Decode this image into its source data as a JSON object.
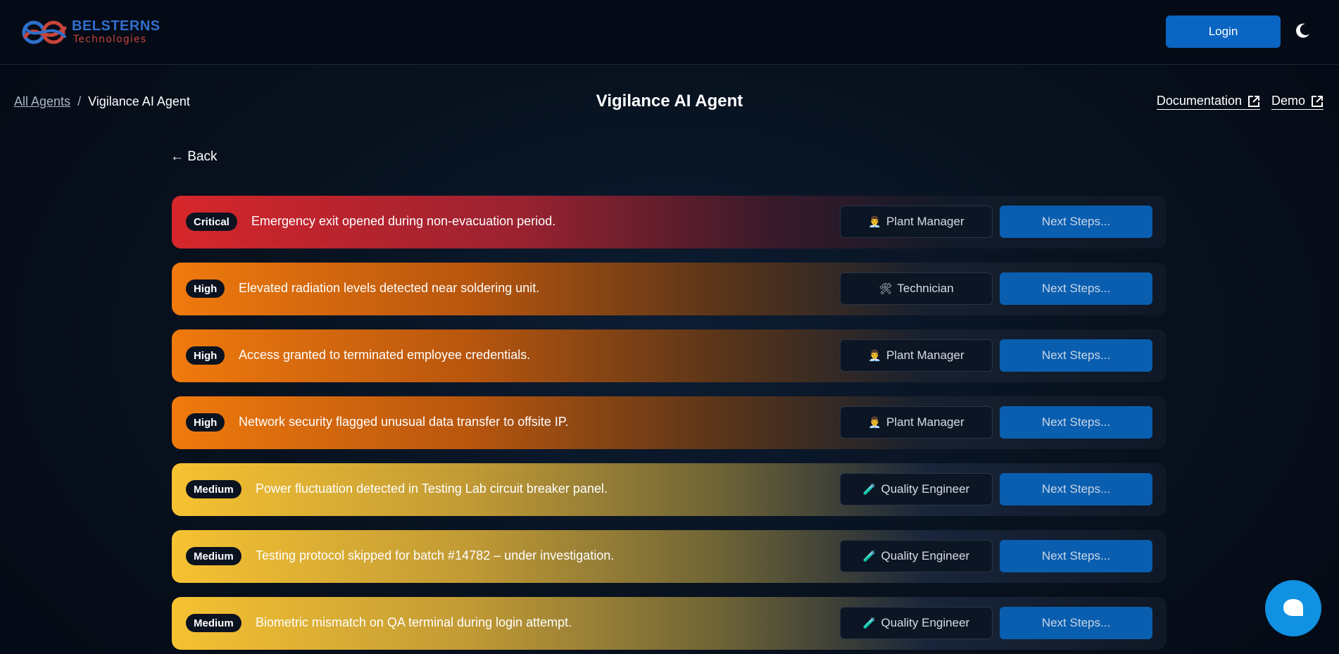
{
  "header": {
    "logo_primary": "BELSTERNS",
    "logo_secondary": "Technologies",
    "login_label": "Login",
    "theme_icon": "moon-icon"
  },
  "breadcrumb": {
    "parent_label": "All Agents",
    "separator": "/",
    "current_label": "Vigilance AI Agent"
  },
  "page": {
    "title": "Vigilance AI Agent",
    "back_label": "← Back"
  },
  "links": {
    "documentation_label": "Documentation",
    "demo_label": "Demo",
    "external_icon": "external-link-icon"
  },
  "alerts": [
    {
      "severity": "Critical",
      "message": "Emergency exit opened during non-evacuation period.",
      "role": "Plant Manager",
      "role_icon": "👨‍💼",
      "action": "Next Steps..."
    },
    {
      "severity": "High",
      "message": "Elevated radiation levels detected near soldering unit.",
      "role": "Technician",
      "role_icon": "🛠",
      "action": "Next Steps..."
    },
    {
      "severity": "High",
      "message": "Access granted to terminated employee credentials.",
      "role": "Plant Manager",
      "role_icon": "👨‍💼",
      "action": "Next Steps..."
    },
    {
      "severity": "High",
      "message": "Network security flagged unusual data transfer to offsite IP.",
      "role": "Plant Manager",
      "role_icon": "👨‍💼",
      "action": "Next Steps..."
    },
    {
      "severity": "Medium",
      "message": "Power fluctuation detected in Testing Lab circuit breaker panel.",
      "role": "Quality Engineer",
      "role_icon": "🧪",
      "action": "Next Steps..."
    },
    {
      "severity": "Medium",
      "message": "Testing protocol skipped for batch #14782 – under investigation.",
      "role": "Quality Engineer",
      "role_icon": "🧪",
      "action": "Next Steps..."
    },
    {
      "severity": "Medium",
      "message": "Biometric mismatch on QA terminal during login attempt.",
      "role": "Quality Engineer",
      "role_icon": "🧪",
      "action": "Next Steps..."
    }
  ],
  "colors": {
    "critical": "#d6262b",
    "high": "#f07a0d",
    "medium": "#f6c232",
    "primary_button": "#0a64c2",
    "chat_button": "#1191e2"
  },
  "chat": {
    "icon": "chat-bubble-icon"
  }
}
